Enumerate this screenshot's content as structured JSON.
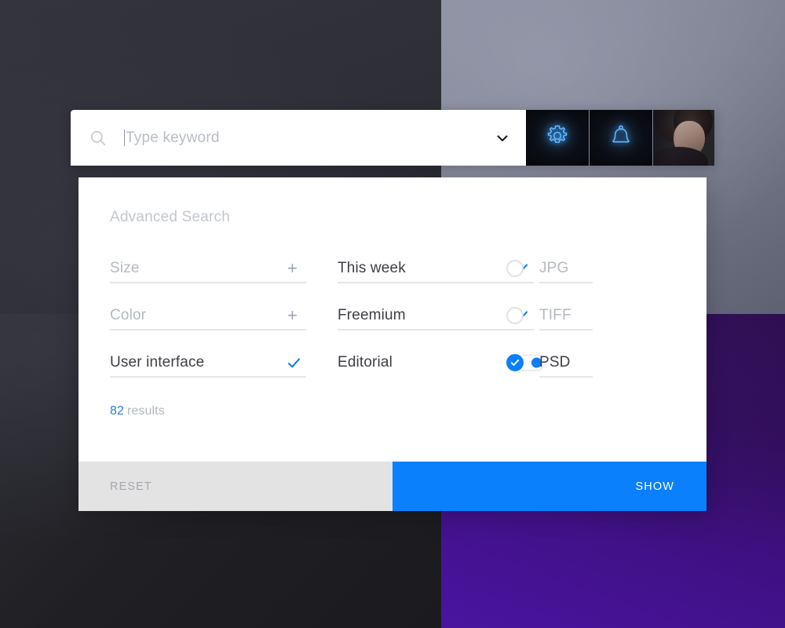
{
  "search": {
    "placeholder": "Type keyword",
    "icon": "search-icon",
    "expand_icon": "chevron-down-icon"
  },
  "topbar": {
    "settings_icon": "gear-icon",
    "notifications_icon": "bell-icon",
    "avatar": "user-avatar"
  },
  "panel": {
    "title": "Advanced Search",
    "columns": [
      {
        "name": "attributes",
        "rows": [
          {
            "label": "Size",
            "control": "plus",
            "state": "collapsed",
            "active": false
          },
          {
            "label": "Color",
            "control": "plus",
            "state": "collapsed",
            "active": false
          },
          {
            "label": "User interface",
            "control": "check",
            "state": "selected",
            "active": true
          }
        ]
      },
      {
        "name": "filters",
        "rows": [
          {
            "label": "This week",
            "control": "check",
            "state": "selected",
            "active": true
          },
          {
            "label": "Freemium",
            "control": "check",
            "state": "selected",
            "active": true
          },
          {
            "label": "Editorial",
            "control": "toggle",
            "state": "on",
            "active": true
          }
        ]
      },
      {
        "name": "formats",
        "rows": [
          {
            "label": "JPG",
            "control": "radio",
            "state": "off",
            "active": false
          },
          {
            "label": "TIFF",
            "control": "radio",
            "state": "off",
            "active": false
          },
          {
            "label": "PSD",
            "control": "radio",
            "state": "on",
            "active": true
          }
        ]
      }
    ],
    "results": {
      "count": "82",
      "word": "results"
    },
    "footer": {
      "reset_label": "RESET",
      "show_label": "SHOW"
    }
  },
  "colors": {
    "accent_blue": "#0a80fd",
    "results_blue": "#2a7df0",
    "muted_text": "#b4b9c2",
    "active_text": "#3c3f45",
    "underline": "#e6e6e8",
    "reset_bg": "#e3e3e4",
    "neon_blue": "#3aa6ff"
  }
}
